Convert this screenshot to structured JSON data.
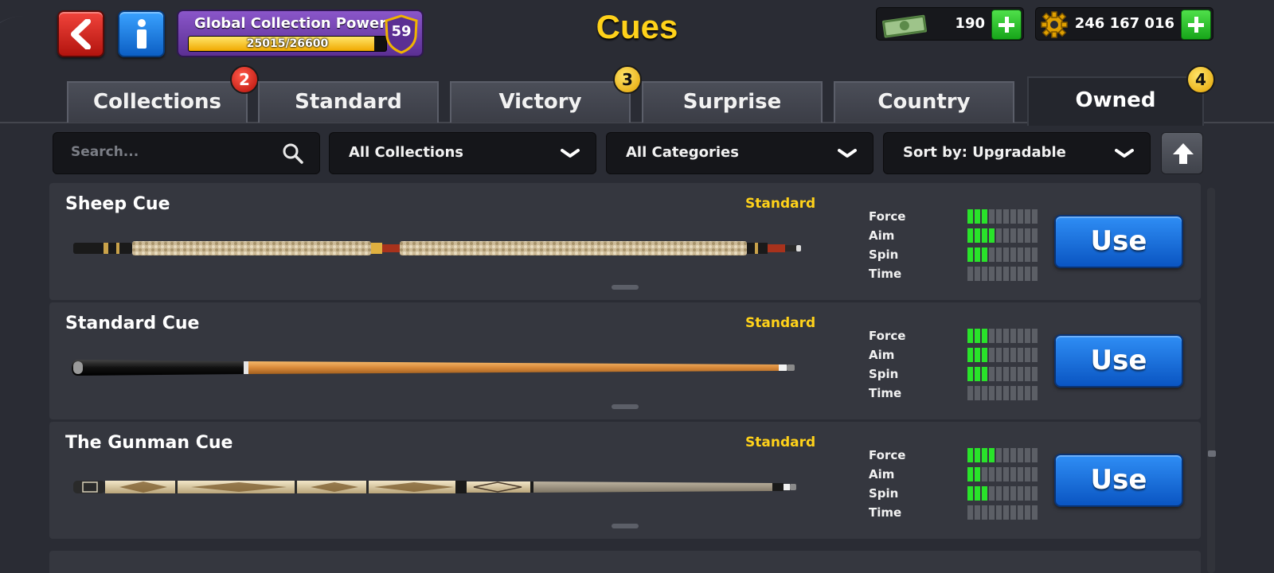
{
  "header": {
    "title": "Cues",
    "collection_power": {
      "label": "Global Collection Power",
      "current": 25015,
      "max": 26600,
      "progress_text": "25015/26600",
      "level": "59"
    },
    "cash": {
      "value": "190",
      "icon": "cash-icon"
    },
    "coins": {
      "value": "246 167 016",
      "icon": "coins-icon"
    }
  },
  "tabs": [
    {
      "label": "Collections",
      "badge": "2",
      "badge_color": "#d21b12"
    },
    {
      "label": "Standard"
    },
    {
      "label": "Victory",
      "badge": "3",
      "badge_color": "#f0b400"
    },
    {
      "label": "Surprise"
    },
    {
      "label": "Country"
    },
    {
      "label": "Owned",
      "badge": "4",
      "badge_color": "#f0b400",
      "active": true
    }
  ],
  "filters": {
    "search_placeholder": "Search...",
    "collections": "All Collections",
    "categories": "All Categories",
    "sort": "Sort by: Upgradable"
  },
  "stat_labels": {
    "force": "Force",
    "aim": "Aim",
    "spin": "Spin",
    "time": "Time"
  },
  "stat_max": 10,
  "cues": [
    {
      "name": "Sheep Cue",
      "category": "Standard",
      "stats": {
        "force": 3,
        "aim": 4,
        "spin": 3,
        "time": 0
      },
      "action": "Use"
    },
    {
      "name": "Standard Cue",
      "category": "Standard",
      "stats": {
        "force": 3,
        "aim": 3,
        "spin": 3,
        "time": 0
      },
      "action": "Use"
    },
    {
      "name": "The Gunman Cue",
      "category": "Standard",
      "stats": {
        "force": 4,
        "aim": 2,
        "spin": 3,
        "time": 0
      },
      "action": "Use"
    }
  ],
  "colors": {
    "accent_yellow": "#ffd21a",
    "stat_on": "#29e32a",
    "use_button": "#1e72e0"
  }
}
